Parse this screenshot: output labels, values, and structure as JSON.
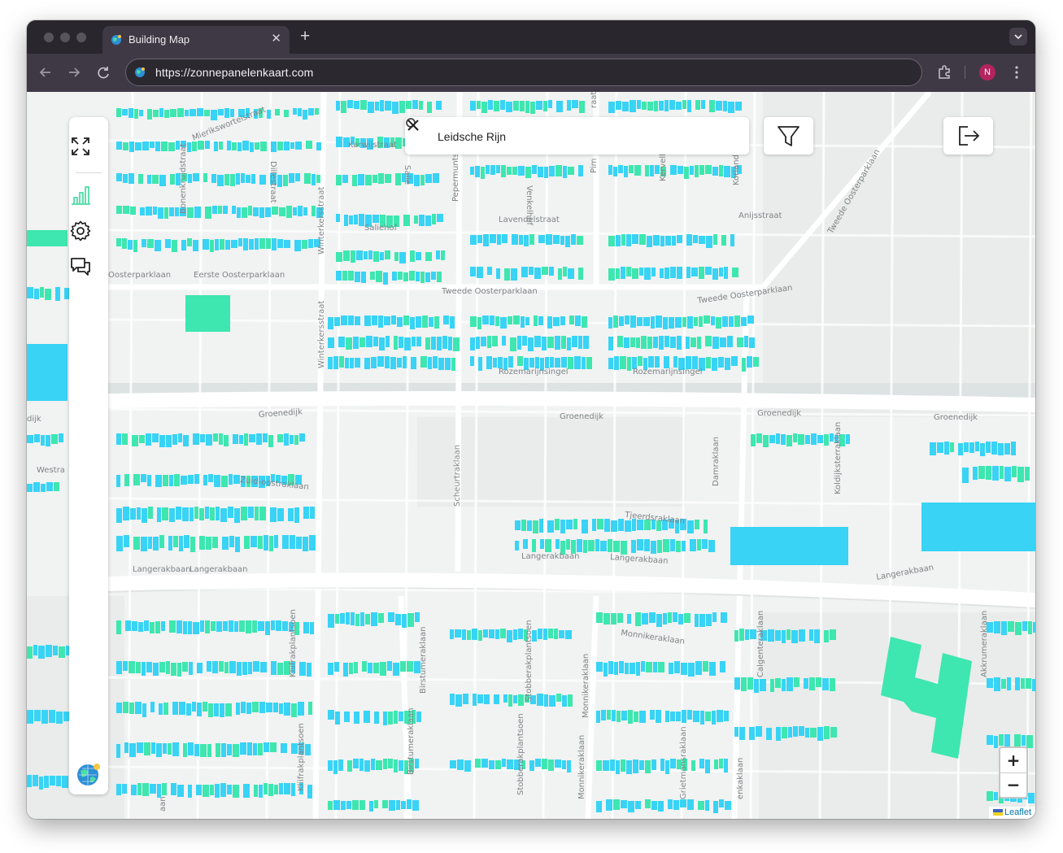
{
  "browser": {
    "tab_title": "Building Map",
    "new_tab_symbol": "+",
    "url": "https://zonnepanelenkaart.com",
    "profile_initial": "N"
  },
  "search": {
    "value": "Leidsche Rijn"
  },
  "sidebar": {
    "items": [
      {
        "icon": "fullscreen-icon"
      },
      {
        "icon": "chart-icon",
        "color": "#4ddca6"
      },
      {
        "icon": "gear-icon"
      },
      {
        "icon": "chat-icon"
      }
    ],
    "bottom_icon": "globe-logo-icon"
  },
  "toolbar": {
    "filter_icon": "filter-icon",
    "logout_icon": "logout-icon"
  },
  "zoom": {
    "in_label": "+",
    "out_label": "−"
  },
  "attribution": {
    "label": "Leaflet"
  },
  "colors": {
    "roof_blue": "#38d3f5",
    "roof_green": "#3ee6b0",
    "map_bg": "#f1f2f2",
    "browser_chrome": "#3f3946"
  },
  "map": {
    "street_labels": [
      "Mierikswortelstraat",
      "Bonenkruidstraat",
      "Dillestraat",
      "Karwijstraat",
      "Salie",
      "Pepermuntstraat",
      "Venkelhof",
      "Pim",
      "raat",
      "Koriand",
      "Kervelhof",
      "Winterkersstraat",
      "Saliehof",
      "Lavendelstraat",
      "Anijsstraat",
      "Tweede Oosterparklaan",
      "Oosterparklaan",
      "Eerste Oosterparklaan",
      "Tweede Oosterparklaan",
      "Tweede Oosterparklaan",
      "Winterkersstraat",
      "Rozemarijnsingel",
      "Rozemarijnsingel",
      "Groenedijk",
      "Groenedijk",
      "Groenedijk",
      "Groenedijk",
      "dijk",
      "Westra",
      "Zuid-oostraklaan",
      "Scheurtraklaan",
      "Damraklaan",
      "Koldijksterraklaan",
      "Tjeerdsraklaan",
      "Langerakbaan",
      "Langerakbaan",
      "Langerakbaan",
      "Langerakbaan",
      "Langerakbaan",
      "Monnikeraklaan",
      "Kliifrakplantsoen",
      "Birstumeraklaan",
      "Stobberakplantsoen",
      "Monnikeraklaan",
      "Calgenteraklaan",
      "Akkrumeraklaan",
      "Birstumeraklaan",
      "Stobberakplantsoen",
      "Monnikeraklaan",
      "Grietmansraklaan",
      "enkaklaan",
      "Kliifrakplantsoen",
      "aan"
    ]
  }
}
